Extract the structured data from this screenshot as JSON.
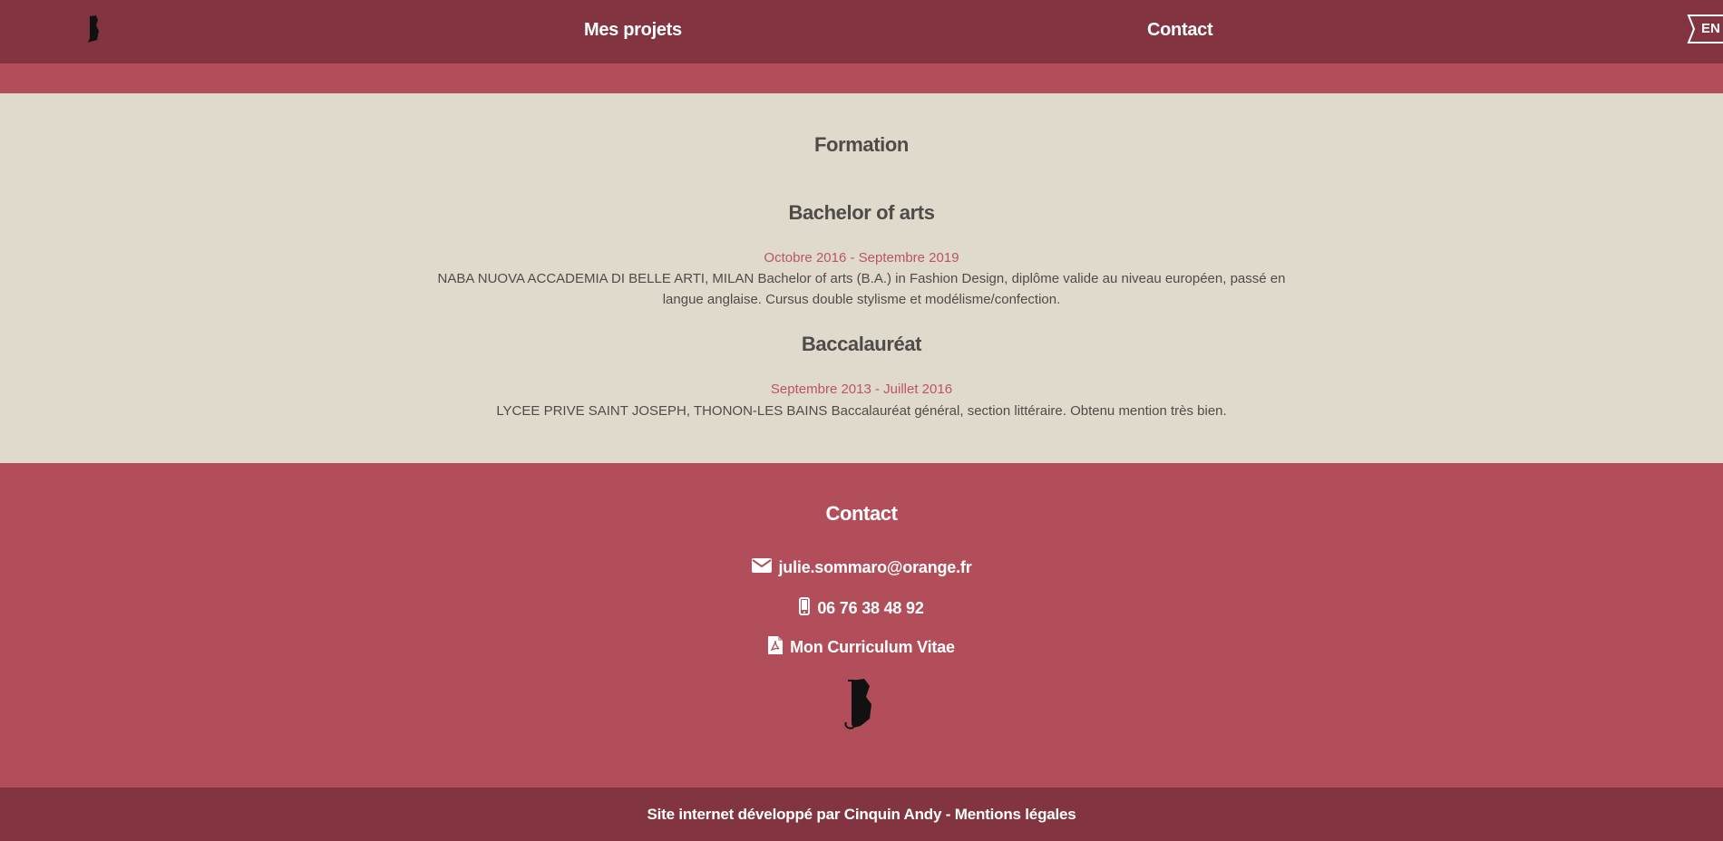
{
  "nav": {
    "links": [
      "Mes projets",
      "Contact"
    ],
    "lang": "EN"
  },
  "formation": {
    "heading": "Formation",
    "entries": [
      {
        "title": "Bachelor of arts",
        "date": "Octobre 2016 - Septembre 2019",
        "description": "NABA NUOVA ACCADEMIA DI BELLE ARTI, MILAN Bachelor of arts (B.A.) in Fashion Design, diplôme valide au niveau européen, passé en langue anglaise. Cursus double stylisme et modélisme/confection."
      },
      {
        "title": "Baccalauréat",
        "date": "Septembre 2013 - Juillet 2016",
        "description": "LYCEE PRIVE SAINT JOSEPH, THONON-LES BAINS Baccalauréat général, section littéraire. Obtenu mention très bien."
      }
    ]
  },
  "contact": {
    "heading": "Contact",
    "email": "julie.sommaro@orange.fr",
    "phone": "06 76 38 48 92",
    "cv": "Mon Curriculum Vitae"
  },
  "footer": {
    "text": "Site internet développé par Cinquin Andy - Mentions légales"
  },
  "colors": {
    "nav_bg": "#823541",
    "accent": "#b14e5a",
    "section_bg": "#e0dacd",
    "date_color": "#b95661",
    "text": "#4f4b49"
  },
  "icons": [
    "logo-icon",
    "envelope-icon",
    "mobile-phone-icon",
    "pdf-file-icon"
  ]
}
